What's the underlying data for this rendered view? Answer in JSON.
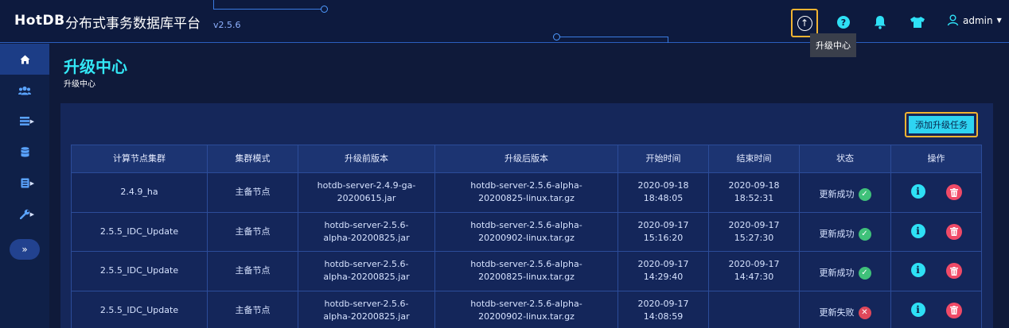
{
  "header": {
    "logo": "HotDB",
    "app_title": "分布式事务数据库平台",
    "version": "v2.5.6",
    "tooltip": "升级中心",
    "user": "admin"
  },
  "page": {
    "title": "升级中心",
    "breadcrumb": "升级中心",
    "add_button": "添加升级任务"
  },
  "sidebar": {
    "items": [
      {
        "icon": "home-icon"
      },
      {
        "icon": "users-icon"
      },
      {
        "icon": "list-icon"
      },
      {
        "icon": "database-icon"
      },
      {
        "icon": "document-icon"
      },
      {
        "icon": "wrench-icon"
      }
    ],
    "collapse_label": "»"
  },
  "table": {
    "headers": [
      "计算节点集群",
      "集群模式",
      "升级前版本",
      "升级后版本",
      "开始时间",
      "结束时间",
      "状态",
      "操作"
    ],
    "rows": [
      {
        "cluster": "2.4.9_ha",
        "mode": "主备节点",
        "before": "hotdb-server-2.4.9-ga-20200615.jar",
        "after": "hotdb-server-2.5.6-alpha-20200825-linux.tar.gz",
        "start": "2020-09-18 18:48:05",
        "end": "2020-09-18 18:52:31",
        "status": "更新成功",
        "success": true
      },
      {
        "cluster": "2.5.5_IDC_Update",
        "mode": "主备节点",
        "before": "hotdb-server-2.5.6-alpha-20200825.jar",
        "after": "hotdb-server-2.5.6-alpha-20200902-linux.tar.gz",
        "start": "2020-09-17 15:16:20",
        "end": "2020-09-17 15:27:30",
        "status": "更新成功",
        "success": true
      },
      {
        "cluster": "2.5.5_IDC_Update",
        "mode": "主备节点",
        "before": "hotdb-server-2.5.6-alpha-20200825.jar",
        "after": "hotdb-server-2.5.6-alpha-20200825-linux.tar.gz",
        "start": "2020-09-17 14:29:40",
        "end": "2020-09-17 14:47:30",
        "status": "更新成功",
        "success": true
      },
      {
        "cluster": "2.5.5_IDC_Update",
        "mode": "主备节点",
        "before": "hotdb-server-2.5.6-alpha-20200825.jar",
        "after": "hotdb-server-2.5.6-alpha-20200902-linux.tar.gz",
        "start": "2020-09-17 14:08:59",
        "end": "",
        "status": "更新失败",
        "success": false
      }
    ]
  },
  "colors": {
    "accent": "#33e8f6",
    "highlight_border": "#f2b431",
    "success": "#3fc17a",
    "fail": "#e0485a",
    "delete": "#f04a67"
  }
}
